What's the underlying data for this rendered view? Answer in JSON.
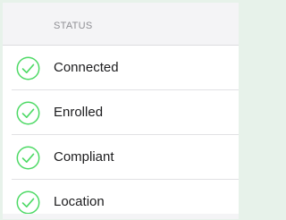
{
  "status_panel": {
    "header": "STATUS",
    "accent_color": "#4cd964",
    "items": [
      {
        "label": "Connected",
        "icon": "check-circle-icon"
      },
      {
        "label": "Enrolled",
        "icon": "check-circle-icon"
      },
      {
        "label": "Compliant",
        "icon": "check-circle-icon"
      },
      {
        "label": "Location",
        "icon": "check-circle-icon"
      }
    ]
  }
}
